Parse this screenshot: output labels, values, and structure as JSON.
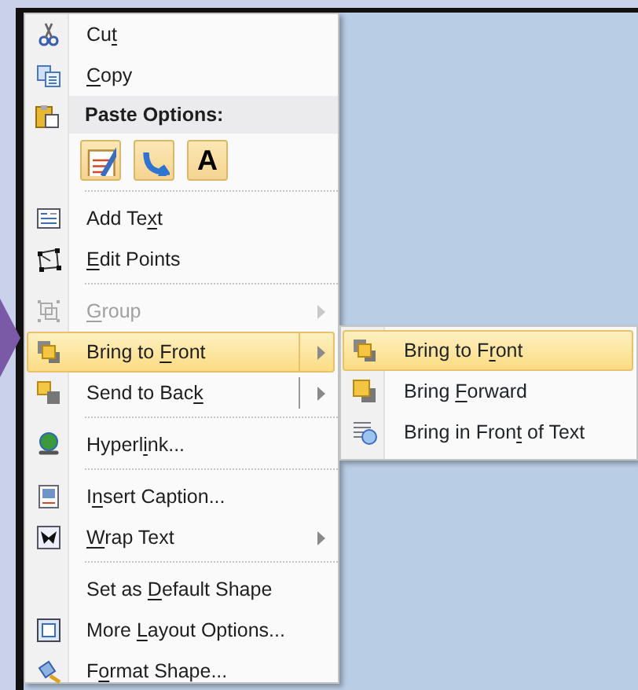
{
  "menu": {
    "groups": [
      [
        {
          "kind": "command",
          "pre": "Cu",
          "key": "t",
          "disabled": false,
          "highlighted": false,
          "submenu": false,
          "split": false
        },
        {
          "kind": "command",
          "key": "C",
          "post": "opy",
          "disabled": false,
          "highlighted": false,
          "submenu": false,
          "split": false
        },
        {
          "kind": "header",
          "label": "Paste Options:"
        },
        {
          "kind": "paste-options",
          "buttons": [
            {
              "kind": "formatting"
            },
            {
              "kind": "merge"
            },
            {
              "kind": "text",
              "glyph": "A"
            }
          ]
        }
      ],
      [
        {
          "kind": "command",
          "pre": "Add Te",
          "key": "x",
          "post": "t",
          "disabled": false,
          "highlighted": false,
          "submenu": false,
          "split": false
        },
        {
          "kind": "command",
          "key": "E",
          "post": "dit Points",
          "disabled": false,
          "highlighted": false,
          "submenu": false,
          "split": false
        }
      ],
      [
        {
          "kind": "command",
          "key": "G",
          "post": "roup",
          "disabled": true,
          "highlighted": false,
          "submenu": true,
          "split": false
        },
        {
          "kind": "command",
          "pre": "Bring to ",
          "key": "F",
          "post": "ront",
          "disabled": false,
          "highlighted": true,
          "submenu": true,
          "split": true
        },
        {
          "kind": "command",
          "pre": "Send to Bac",
          "key": "k",
          "disabled": false,
          "highlighted": false,
          "submenu": true,
          "split": true
        }
      ],
      [
        {
          "kind": "command",
          "pre": "Hyperl",
          "key": "i",
          "post": "nk...",
          "disabled": false,
          "highlighted": false,
          "submenu": false,
          "split": false
        }
      ],
      [
        {
          "kind": "command",
          "pre": "I",
          "key": "n",
          "post": "sert Caption...",
          "disabled": false,
          "highlighted": false,
          "submenu": false,
          "split": false
        },
        {
          "kind": "command",
          "key": "W",
          "post": "rap Text",
          "disabled": false,
          "highlighted": false,
          "submenu": true,
          "split": false
        }
      ],
      [
        {
          "kind": "command",
          "pre": "Set as ",
          "key": "D",
          "post": "efault Shape",
          "disabled": false,
          "highlighted": false,
          "submenu": false,
          "split": false
        },
        {
          "kind": "command",
          "pre": "More ",
          "key": "L",
          "post": "ayout Options...",
          "disabled": false,
          "highlighted": false,
          "submenu": false,
          "split": false
        },
        {
          "kind": "command",
          "pre": "F",
          "key": "o",
          "post": "rmat Shape...",
          "disabled": false,
          "highlighted": false,
          "submenu": false,
          "split": false
        }
      ]
    ]
  },
  "submenu": {
    "items": [
      {
        "pre": "Bring to F",
        "key": "r",
        "post": "ont",
        "highlighted": true
      },
      {
        "pre": "Bring ",
        "key": "F",
        "post": "orward",
        "highlighted": false
      },
      {
        "pre": "Bring in Fron",
        "key": "t",
        "post": " of Text",
        "highlighted": false
      }
    ]
  }
}
